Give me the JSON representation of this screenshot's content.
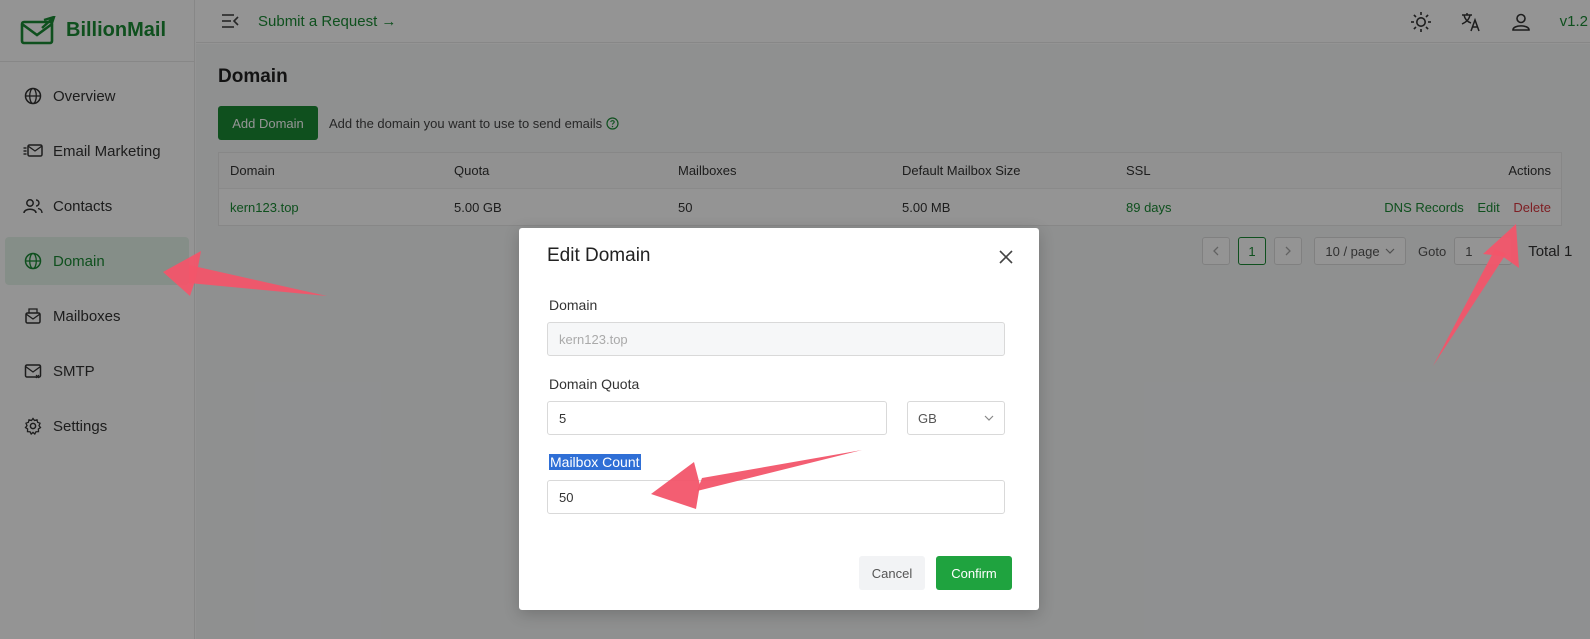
{
  "app": {
    "name": "BillionMail",
    "version": "v1.2"
  },
  "header": {
    "submit_request": "Submit a Request",
    "submit_arrow": "→"
  },
  "icons": {
    "logo": "envelope-logo-icon",
    "collapse": "menu-collapse-icon",
    "theme": "sun-icon",
    "language": "translate-icon",
    "user": "user-icon"
  },
  "sidebar": {
    "items": [
      {
        "label": "Overview",
        "icon": "globe-icon",
        "active": false
      },
      {
        "label": "Email Marketing",
        "icon": "mail-send-icon",
        "active": false
      },
      {
        "label": "Contacts",
        "icon": "contacts-icon",
        "active": false
      },
      {
        "label": "Domain",
        "icon": "globe-icon",
        "active": true
      },
      {
        "label": "Mailboxes",
        "icon": "mailbox-icon",
        "active": false
      },
      {
        "label": "SMTP",
        "icon": "smtp-icon",
        "active": false
      },
      {
        "label": "Settings",
        "icon": "gear-icon",
        "active": false
      }
    ]
  },
  "page": {
    "title": "Domain",
    "add_button": "Add Domain",
    "add_hint": "Add the domain you want to use to send emails"
  },
  "table": {
    "columns": [
      "Domain",
      "Quota",
      "Mailboxes",
      "Default Mailbox Size",
      "SSL",
      "Actions"
    ],
    "rows": [
      {
        "domain": "kern123.top",
        "quota": "5.00 GB",
        "mailboxes": "50",
        "default_size": "5.00 MB",
        "ssl": "89 days",
        "actions": {
          "dns": "DNS Records",
          "edit": "Edit",
          "delete": "Delete"
        }
      }
    ]
  },
  "pagination": {
    "current": "1",
    "page_size": "10 / page",
    "goto_label": "Goto",
    "goto_value": "1",
    "total": "Total 1"
  },
  "modal": {
    "title": "Edit Domain",
    "domain_label": "Domain",
    "domain_value": "kern123.top",
    "quota_label": "Domain Quota",
    "quota_value": "5",
    "quota_unit": "GB",
    "mailbox_label": "Mailbox Count",
    "mailbox_value": "50",
    "cancel": "Cancel",
    "confirm": "Confirm"
  },
  "colors": {
    "brand": "#1a8a35",
    "danger": "#d9363e",
    "annotation_arrow": "#f2556a",
    "selection": "#2f6fd6"
  }
}
